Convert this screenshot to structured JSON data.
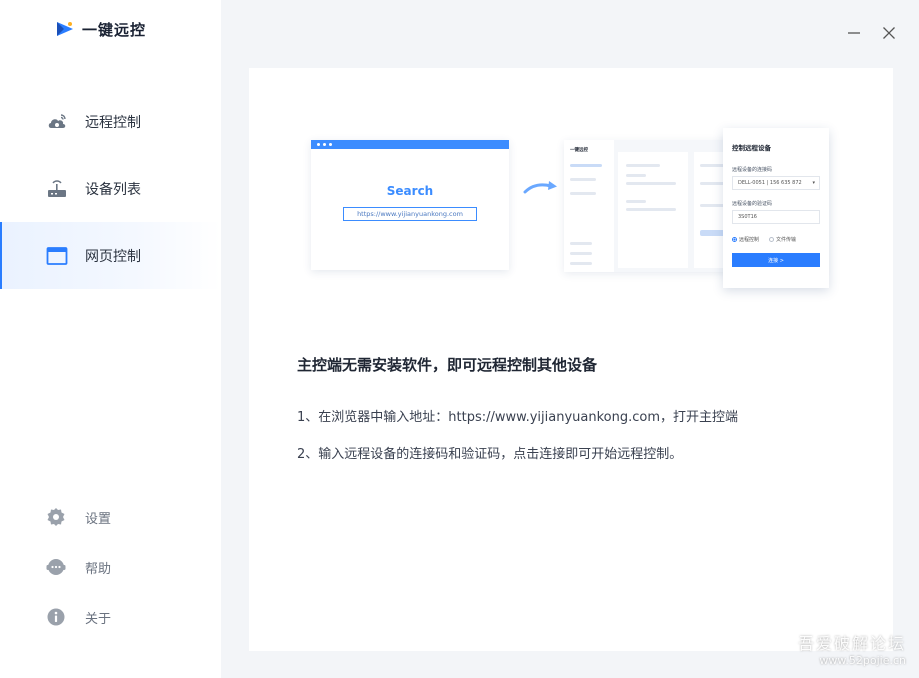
{
  "app": {
    "name": "一键远控"
  },
  "nav": [
    {
      "label": "远程控制",
      "icon": "cloud-remote-icon"
    },
    {
      "label": "设备列表",
      "icon": "device-list-icon"
    },
    {
      "label": "网页控制",
      "icon": "browser-window-icon",
      "active": true
    }
  ],
  "bottom_nav": [
    {
      "label": "设置",
      "icon": "gear-icon"
    },
    {
      "label": "帮助",
      "icon": "help-chat-icon"
    },
    {
      "label": "关于",
      "icon": "info-icon"
    }
  ],
  "window": {
    "minimize_icon": "minimize-icon",
    "close_icon": "close-icon"
  },
  "illustration": {
    "browser": {
      "search_label": "Search",
      "url": "https://www.yijianyuankong.com"
    },
    "mini_app_name": "一键远控",
    "panel": {
      "title": "控制远程设备",
      "code_label": "远程设备的连接码",
      "code_value": "DELL-0051 | 156 635 872",
      "verify_label": "远程设备的验证码",
      "verify_value": "3S0T16",
      "radio_remote": "远程控制",
      "radio_file": "文件传输",
      "connect_button": "连接 >"
    }
  },
  "content": {
    "heading": "主控端无需安装软件，即可远程控制其他设备",
    "step1": "1、在浏览器中输入地址：https://www.yijianyuankong.com，打开主控端",
    "step2": "2、输入远程设备的连接码和验证码，点击连接即可开始远程控制。"
  },
  "watermark": {
    "title": "吾爱破解论坛",
    "url": "www.52pojie.cn"
  },
  "colors": {
    "accent": "#2a7dff",
    "sidebar_bg": "#ffffff",
    "page_bg": "#f3f5f8"
  }
}
